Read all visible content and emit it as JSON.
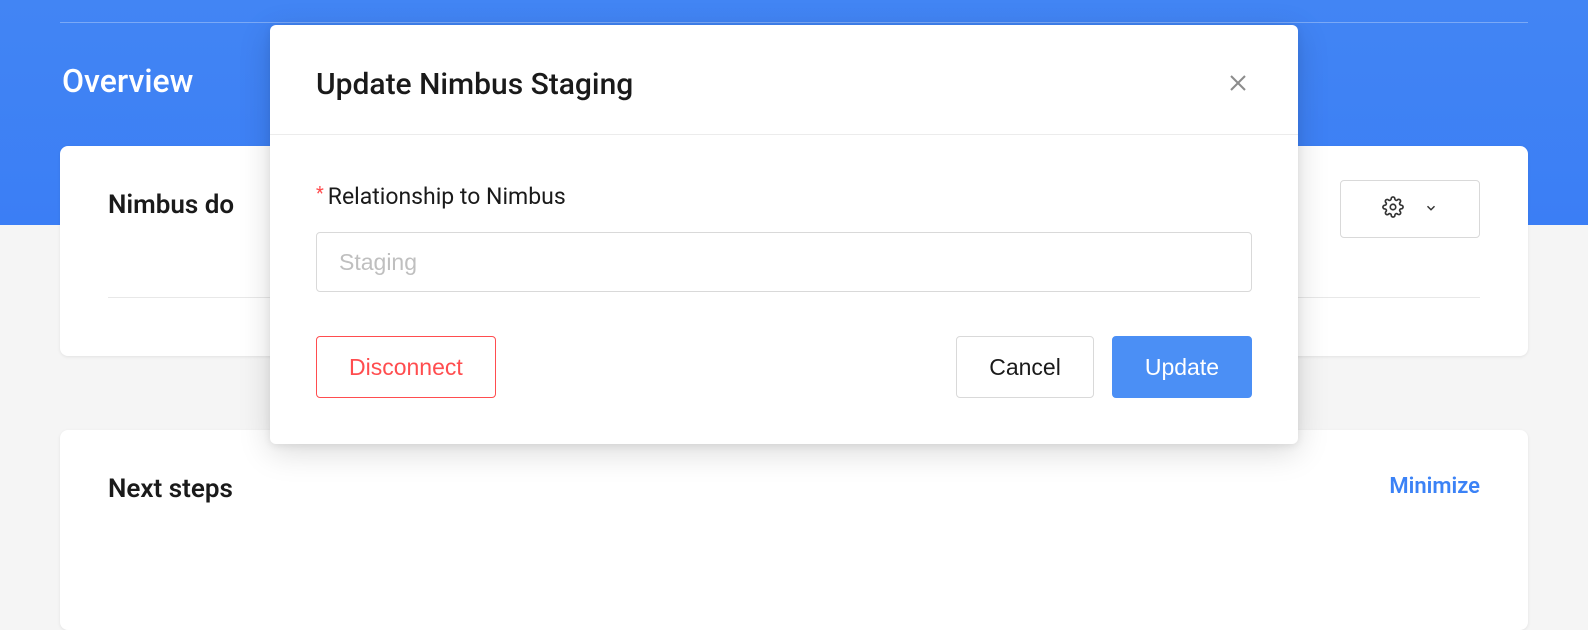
{
  "header": {
    "overview_label": "Overview"
  },
  "card1": {
    "title": "Nimbus do"
  },
  "card2": {
    "title": "Next steps",
    "minimize_label": "Minimize"
  },
  "modal": {
    "title": "Update Nimbus Staging",
    "field_label": "Relationship to Nimbus",
    "field_placeholder": "Staging",
    "disconnect_label": "Disconnect",
    "cancel_label": "Cancel",
    "update_label": "Update"
  }
}
